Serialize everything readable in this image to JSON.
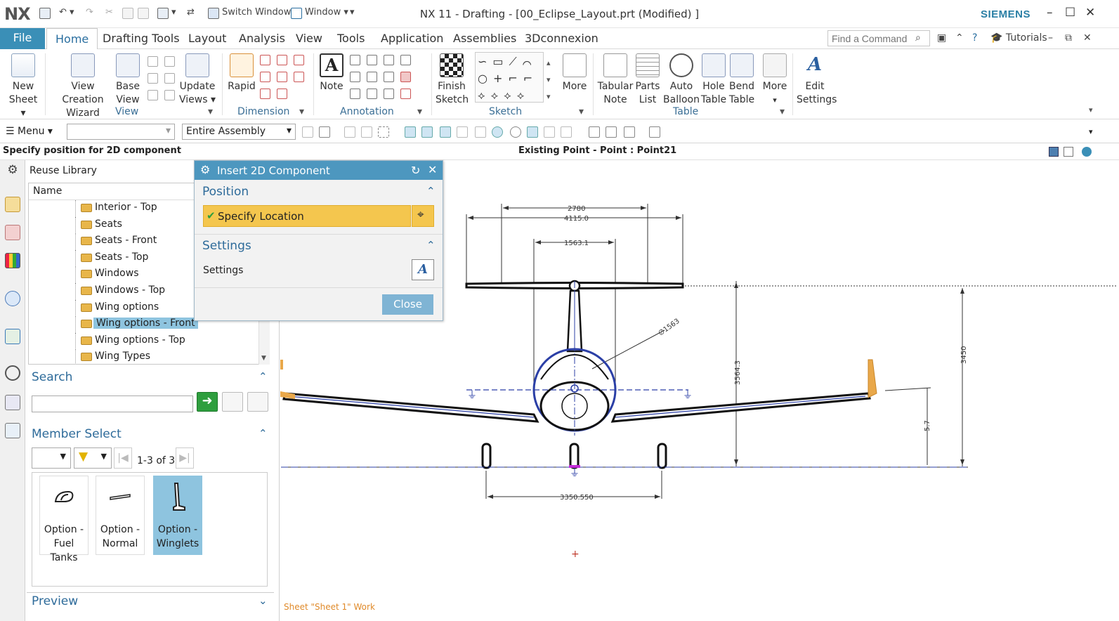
{
  "app": {
    "logo": "NX",
    "title": "NX 11 - Drafting - [00_Eclipse_Layout.prt (Modified) ]",
    "brand": "SIEMENS",
    "switch_window": "Switch Window",
    "window": "Window"
  },
  "tabs": {
    "file": "File",
    "items": [
      "Home",
      "Drafting Tools",
      "Layout",
      "Analysis",
      "View",
      "Tools",
      "Application",
      "Assemblies",
      "3Dconnexion"
    ],
    "find_placeholder": "Find a Command",
    "tutorials": "Tutorials"
  },
  "ribbon": {
    "new_sheet": [
      "New",
      "Sheet ▾"
    ],
    "view_creation_wizard": [
      "View Creation",
      "Wizard"
    ],
    "base_view": [
      "Base",
      "View"
    ],
    "update_views": [
      "Update",
      "Views ▾"
    ],
    "rapid": "Rapid",
    "note": "Note",
    "finish_sketch": [
      "Finish",
      "Sketch"
    ],
    "more_sketch": "More",
    "tabular_note": [
      "Tabular",
      "Note"
    ],
    "parts_list": [
      "Parts",
      "List"
    ],
    "auto_balloon": [
      "Auto",
      "Balloon"
    ],
    "hole_table": [
      "Hole",
      "Table"
    ],
    "bend_table": [
      "Bend",
      "Table"
    ],
    "more_table": "More",
    "edit_settings": [
      "Edit",
      "Settings"
    ],
    "groups": {
      "view": "View",
      "dimension": "Dimension",
      "annotation": "Annotation",
      "sketch": "Sketch",
      "table": "Table"
    }
  },
  "toolbar2": {
    "menu": "Menu ▾",
    "filter_value": "",
    "assembly_scope": "Entire Assembly"
  },
  "status": {
    "prompt": "Specify position for 2D component",
    "selection": "Existing Point - Point : Point21"
  },
  "nav": {
    "title": "Reuse Library",
    "column_name": "Name",
    "tree_items": [
      "Interior - Top",
      "Seats",
      "Seats - Front",
      "Seats - Top",
      "Windows",
      "Windows - Top",
      "Wing options",
      "Wing options - Front",
      "Wing options - Top",
      "Wing Types"
    ],
    "selected_item": "Wing options - Front",
    "search_label": "Search",
    "search_value": "",
    "member_select_label": "Member Select",
    "page_count": "1-3 of 3",
    "members": [
      [
        "Option -",
        "Fuel Tanks"
      ],
      [
        "Option -",
        "Normal"
      ],
      [
        "Option -",
        "Winglets"
      ]
    ],
    "selected_member": "Option - Winglets",
    "preview_label": "Preview"
  },
  "dialog": {
    "title": "Insert 2D Component",
    "position_label": "Position",
    "specify_location": "Specify Location",
    "settings_label": "Settings",
    "settings_row": "Settings",
    "close": "Close"
  },
  "drawing": {
    "dim_2780": "2780",
    "dim_4115": "4115.0",
    "dim_1563": "1563.1",
    "dim_diameter": "∅1563",
    "dim_3564": "3564.3",
    "dim_3450": "3450",
    "dim_57": "5.7",
    "dim_3350": "3350.550",
    "sheet_label": "Sheet \"Sheet 1\" Work"
  },
  "colors": {
    "accent": "#3a8fb7",
    "dialog_title": "#4d97bf",
    "location_highlight": "#f4c64e",
    "selection": "#8ec4df",
    "winglet": "#e9a84a",
    "dimension": "#333333",
    "geometry": "#2b3fa6"
  }
}
